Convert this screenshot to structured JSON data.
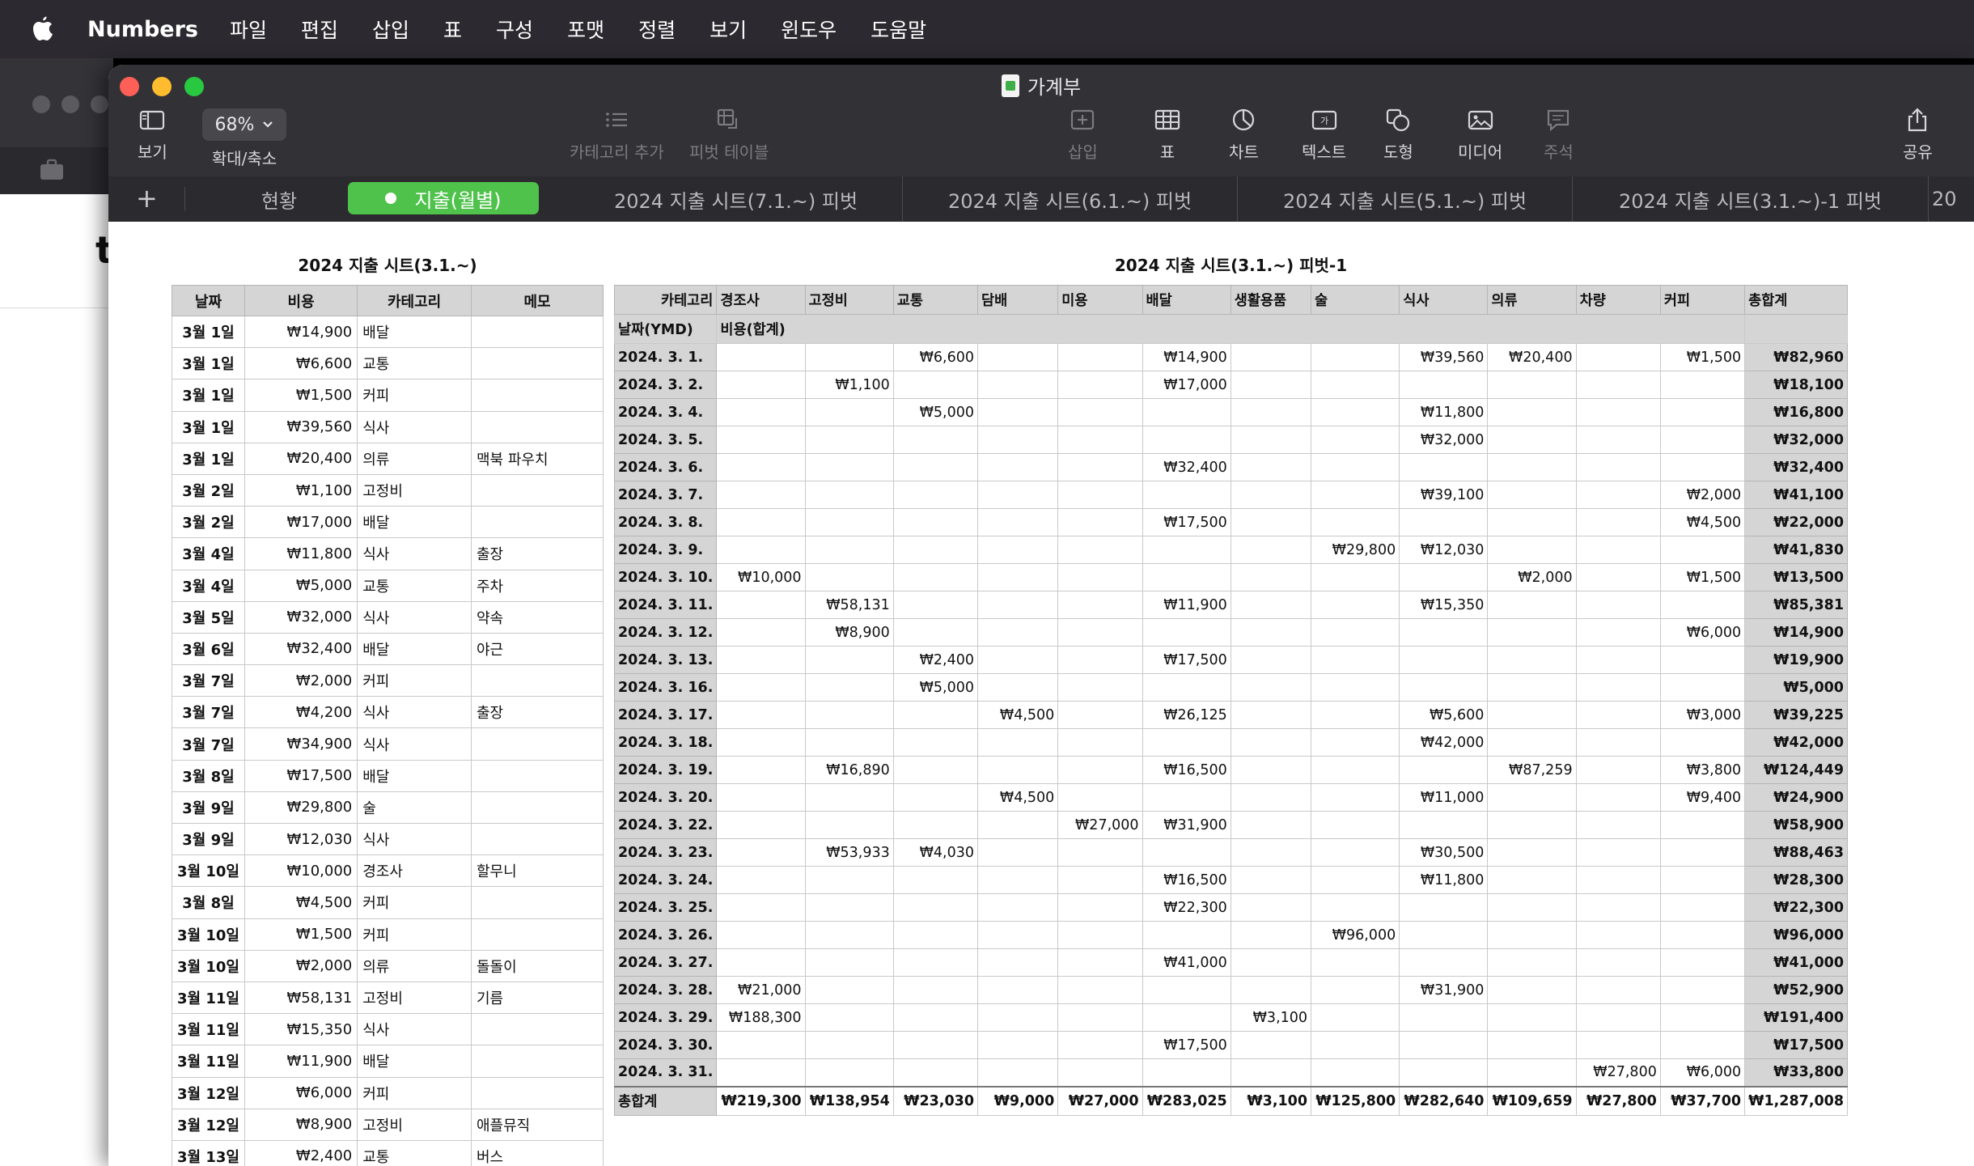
{
  "menubar": {
    "app_name": "Numbers",
    "items": [
      "파일",
      "편집",
      "삽입",
      "표",
      "구성",
      "포맷",
      "정렬",
      "보기",
      "윈도우",
      "도움말"
    ]
  },
  "back_window": {
    "text": "t"
  },
  "window": {
    "title": "가계부",
    "toolbar": {
      "view": "보기",
      "zoom_value": "68%",
      "zoom": "확대/축소",
      "add_category": "카테고리 추가",
      "pivot_table": "피벗 테이블",
      "insert": "삽입",
      "table": "표",
      "chart": "차트",
      "text": "텍스트",
      "shape": "도형",
      "media": "미디어",
      "comment": "주석",
      "share": "공유"
    },
    "tabs": [
      "현황",
      "지출(월별)",
      "2024 지출 시트(7.1.~) 피벗",
      "2024 지출 시트(6.1.~) 피벗",
      "2024 지출 시트(5.1.~) 피벗",
      "2024 지출 시트(3.1.~)-1 피벗",
      "20"
    ],
    "active_tab_index": 1,
    "accent": "#4ec24a"
  },
  "table1": {
    "title": "2024 지출 시트(3.1.~)",
    "headers": [
      "날짜",
      "비용",
      "카테고리",
      "메모"
    ],
    "rows": [
      [
        "3월 1일",
        "₩14,900",
        "배달",
        ""
      ],
      [
        "3월 1일",
        "₩6,600",
        "교통",
        ""
      ],
      [
        "3월 1일",
        "₩1,500",
        "커피",
        ""
      ],
      [
        "3월 1일",
        "₩39,560",
        "식사",
        ""
      ],
      [
        "3월 1일",
        "₩20,400",
        "의류",
        "맥북 파우치"
      ],
      [
        "3월 2일",
        "₩1,100",
        "고정비",
        ""
      ],
      [
        "3월 2일",
        "₩17,000",
        "배달",
        ""
      ],
      [
        "3월 4일",
        "₩11,800",
        "식사",
        "출장"
      ],
      [
        "3월 4일",
        "₩5,000",
        "교통",
        "주차"
      ],
      [
        "3월 5일",
        "₩32,000",
        "식사",
        "약속"
      ],
      [
        "3월 6일",
        "₩32,400",
        "배달",
        "야근"
      ],
      [
        "3월 7일",
        "₩2,000",
        "커피",
        ""
      ],
      [
        "3월 7일",
        "₩4,200",
        "식사",
        "출장"
      ],
      [
        "3월 7일",
        "₩34,900",
        "식사",
        ""
      ],
      [
        "3월 8일",
        "₩17,500",
        "배달",
        ""
      ],
      [
        "3월 9일",
        "₩29,800",
        "술",
        ""
      ],
      [
        "3월 9일",
        "₩12,030",
        "식사",
        ""
      ],
      [
        "3월 10일",
        "₩10,000",
        "경조사",
        "할무니"
      ],
      [
        "3월 8일",
        "₩4,500",
        "커피",
        ""
      ],
      [
        "3월 10일",
        "₩1,500",
        "커피",
        ""
      ],
      [
        "3월 10일",
        "₩2,000",
        "의류",
        "돌돌이"
      ],
      [
        "3월 11일",
        "₩58,131",
        "고정비",
        "기름"
      ],
      [
        "3월 11일",
        "₩15,350",
        "식사",
        ""
      ],
      [
        "3월 11일",
        "₩11,900",
        "배달",
        ""
      ],
      [
        "3월 12일",
        "₩6,000",
        "커피",
        ""
      ],
      [
        "3월 12일",
        "₩8,900",
        "고정비",
        "애플뮤직"
      ],
      [
        "3월 13일",
        "₩2,400",
        "교통",
        "버스"
      ]
    ]
  },
  "table2": {
    "title": "2024 지출 시트(3.1.~) 피벗-1",
    "corner": "카테고리",
    "columns": [
      "경조사",
      "고정비",
      "교통",
      "담배",
      "미용",
      "배달",
      "생활용품",
      "술",
      "식사",
      "의류",
      "차량",
      "커피",
      "총합계"
    ],
    "row_header": "날짜(YMD)",
    "value_header": "비용(합계)",
    "rows": [
      [
        "2024. 3. 1.",
        "",
        "",
        "₩6,600",
        "",
        "",
        "₩14,900",
        "",
        "",
        "₩39,560",
        "₩20,400",
        "",
        "₩1,500",
        "₩82,960"
      ],
      [
        "2024. 3. 2.",
        "",
        "₩1,100",
        "",
        "",
        "",
        "₩17,000",
        "",
        "",
        "",
        "",
        "",
        "",
        "₩18,100"
      ],
      [
        "2024. 3. 4.",
        "",
        "",
        "₩5,000",
        "",
        "",
        "",
        "",
        "",
        "₩11,800",
        "",
        "",
        "",
        "₩16,800"
      ],
      [
        "2024. 3. 5.",
        "",
        "",
        "",
        "",
        "",
        "",
        "",
        "",
        "₩32,000",
        "",
        "",
        "",
        "₩32,000"
      ],
      [
        "2024. 3. 6.",
        "",
        "",
        "",
        "",
        "",
        "₩32,400",
        "",
        "",
        "",
        "",
        "",
        "",
        "₩32,400"
      ],
      [
        "2024. 3. 7.",
        "",
        "",
        "",
        "",
        "",
        "",
        "",
        "",
        "₩39,100",
        "",
        "",
        "₩2,000",
        "₩41,100"
      ],
      [
        "2024. 3. 8.",
        "",
        "",
        "",
        "",
        "",
        "₩17,500",
        "",
        "",
        "",
        "",
        "",
        "₩4,500",
        "₩22,000"
      ],
      [
        "2024. 3. 9.",
        "",
        "",
        "",
        "",
        "",
        "",
        "",
        "₩29,800",
        "₩12,030",
        "",
        "",
        "",
        "₩41,830"
      ],
      [
        "2024. 3. 10.",
        "₩10,000",
        "",
        "",
        "",
        "",
        "",
        "",
        "",
        "",
        "₩2,000",
        "",
        "₩1,500",
        "₩13,500"
      ],
      [
        "2024. 3. 11.",
        "",
        "₩58,131",
        "",
        "",
        "",
        "₩11,900",
        "",
        "",
        "₩15,350",
        "",
        "",
        "",
        "₩85,381"
      ],
      [
        "2024. 3. 12.",
        "",
        "₩8,900",
        "",
        "",
        "",
        "",
        "",
        "",
        "",
        "",
        "",
        "₩6,000",
        "₩14,900"
      ],
      [
        "2024. 3. 13.",
        "",
        "",
        "₩2,400",
        "",
        "",
        "₩17,500",
        "",
        "",
        "",
        "",
        "",
        "",
        "₩19,900"
      ],
      [
        "2024. 3. 16.",
        "",
        "",
        "₩5,000",
        "",
        "",
        "",
        "",
        "",
        "",
        "",
        "",
        "",
        "₩5,000"
      ],
      [
        "2024. 3. 17.",
        "",
        "",
        "",
        "₩4,500",
        "",
        "₩26,125",
        "",
        "",
        "₩5,600",
        "",
        "",
        "₩3,000",
        "₩39,225"
      ],
      [
        "2024. 3. 18.",
        "",
        "",
        "",
        "",
        "",
        "",
        "",
        "",
        "₩42,000",
        "",
        "",
        "",
        "₩42,000"
      ],
      [
        "2024. 3. 19.",
        "",
        "₩16,890",
        "",
        "",
        "",
        "₩16,500",
        "",
        "",
        "",
        "₩87,259",
        "",
        "₩3,800",
        "₩124,449"
      ],
      [
        "2024. 3. 20.",
        "",
        "",
        "",
        "₩4,500",
        "",
        "",
        "",
        "",
        "₩11,000",
        "",
        "",
        "₩9,400",
        "₩24,900"
      ],
      [
        "2024. 3. 22.",
        "",
        "",
        "",
        "",
        "₩27,000",
        "₩31,900",
        "",
        "",
        "",
        "",
        "",
        "",
        "₩58,900"
      ],
      [
        "2024. 3. 23.",
        "",
        "₩53,933",
        "₩4,030",
        "",
        "",
        "",
        "",
        "",
        "₩30,500",
        "",
        "",
        "",
        "₩88,463"
      ],
      [
        "2024. 3. 24.",
        "",
        "",
        "",
        "",
        "",
        "₩16,500",
        "",
        "",
        "₩11,800",
        "",
        "",
        "",
        "₩28,300"
      ],
      [
        "2024. 3. 25.",
        "",
        "",
        "",
        "",
        "",
        "₩22,300",
        "",
        "",
        "",
        "",
        "",
        "",
        "₩22,300"
      ],
      [
        "2024. 3. 26.",
        "",
        "",
        "",
        "",
        "",
        "",
        "",
        "₩96,000",
        "",
        "",
        "",
        "",
        "₩96,000"
      ],
      [
        "2024. 3. 27.",
        "",
        "",
        "",
        "",
        "",
        "₩41,000",
        "",
        "",
        "",
        "",
        "",
        "",
        "₩41,000"
      ],
      [
        "2024. 3. 28.",
        "₩21,000",
        "",
        "",
        "",
        "",
        "",
        "",
        "",
        "₩31,900",
        "",
        "",
        "",
        "₩52,900"
      ],
      [
        "2024. 3. 29.",
        "₩188,300",
        "",
        "",
        "",
        "",
        "",
        "₩3,100",
        "",
        "",
        "",
        "",
        "",
        "₩191,400"
      ],
      [
        "2024. 3. 30.",
        "",
        "",
        "",
        "",
        "",
        "₩17,500",
        "",
        "",
        "",
        "",
        "",
        "",
        "₩17,500"
      ],
      [
        "2024. 3. 31.",
        "",
        "",
        "",
        "",
        "",
        "",
        "",
        "",
        "",
        "",
        "₩27,800",
        "₩6,000",
        "₩33,800"
      ]
    ],
    "total_label": "총합계",
    "totals": [
      "₩219,300",
      "₩138,954",
      "₩23,030",
      "₩9,000",
      "₩27,000",
      "₩283,025",
      "₩3,100",
      "₩125,800",
      "₩282,640",
      "₩109,659",
      "₩27,800",
      "₩37,700",
      "₩1,287,008"
    ]
  }
}
